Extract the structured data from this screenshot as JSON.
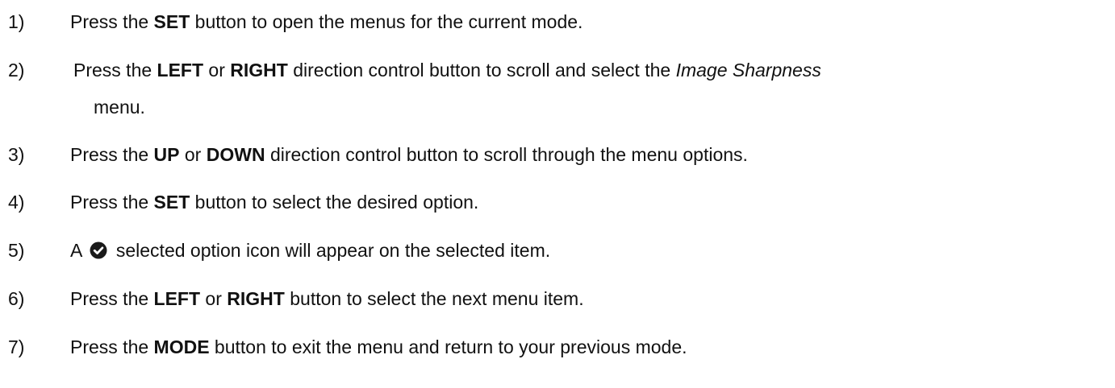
{
  "steps": [
    {
      "num": "1)",
      "pre": "Press the ",
      "b1": "SET",
      "post": " button to open the menus for the current mode."
    },
    {
      "num": "2)",
      "pre": "Press the ",
      "b1": "LEFT",
      "mid": " or ",
      "b2": "RIGHT",
      "post": " direction control button to scroll and select the ",
      "italic": "Image Sharpness",
      "cont": "menu."
    },
    {
      "num": "3)",
      "pre": "Press the ",
      "b1": "UP",
      "mid": " or ",
      "b2": "DOWN",
      "post": " direction control button to scroll through the menu options."
    },
    {
      "num": "4)",
      "pre": "Press the ",
      "b1": "SET",
      "post": " button to select the desired option."
    },
    {
      "num": "5)",
      "pre": "A",
      "post": "selected option icon will appear on the selected item."
    },
    {
      "num": "6)",
      "pre": "Press the ",
      "b1": "LEFT",
      "mid": " or ",
      "b2": "RIGHT",
      "post": " button to select the next menu item."
    },
    {
      "num": "7)",
      "pre": "Press the ",
      "b1": "MODE",
      "post": " button to exit the menu and return to your previous mode."
    }
  ],
  "icons": {
    "check": "check-circle-icon"
  }
}
